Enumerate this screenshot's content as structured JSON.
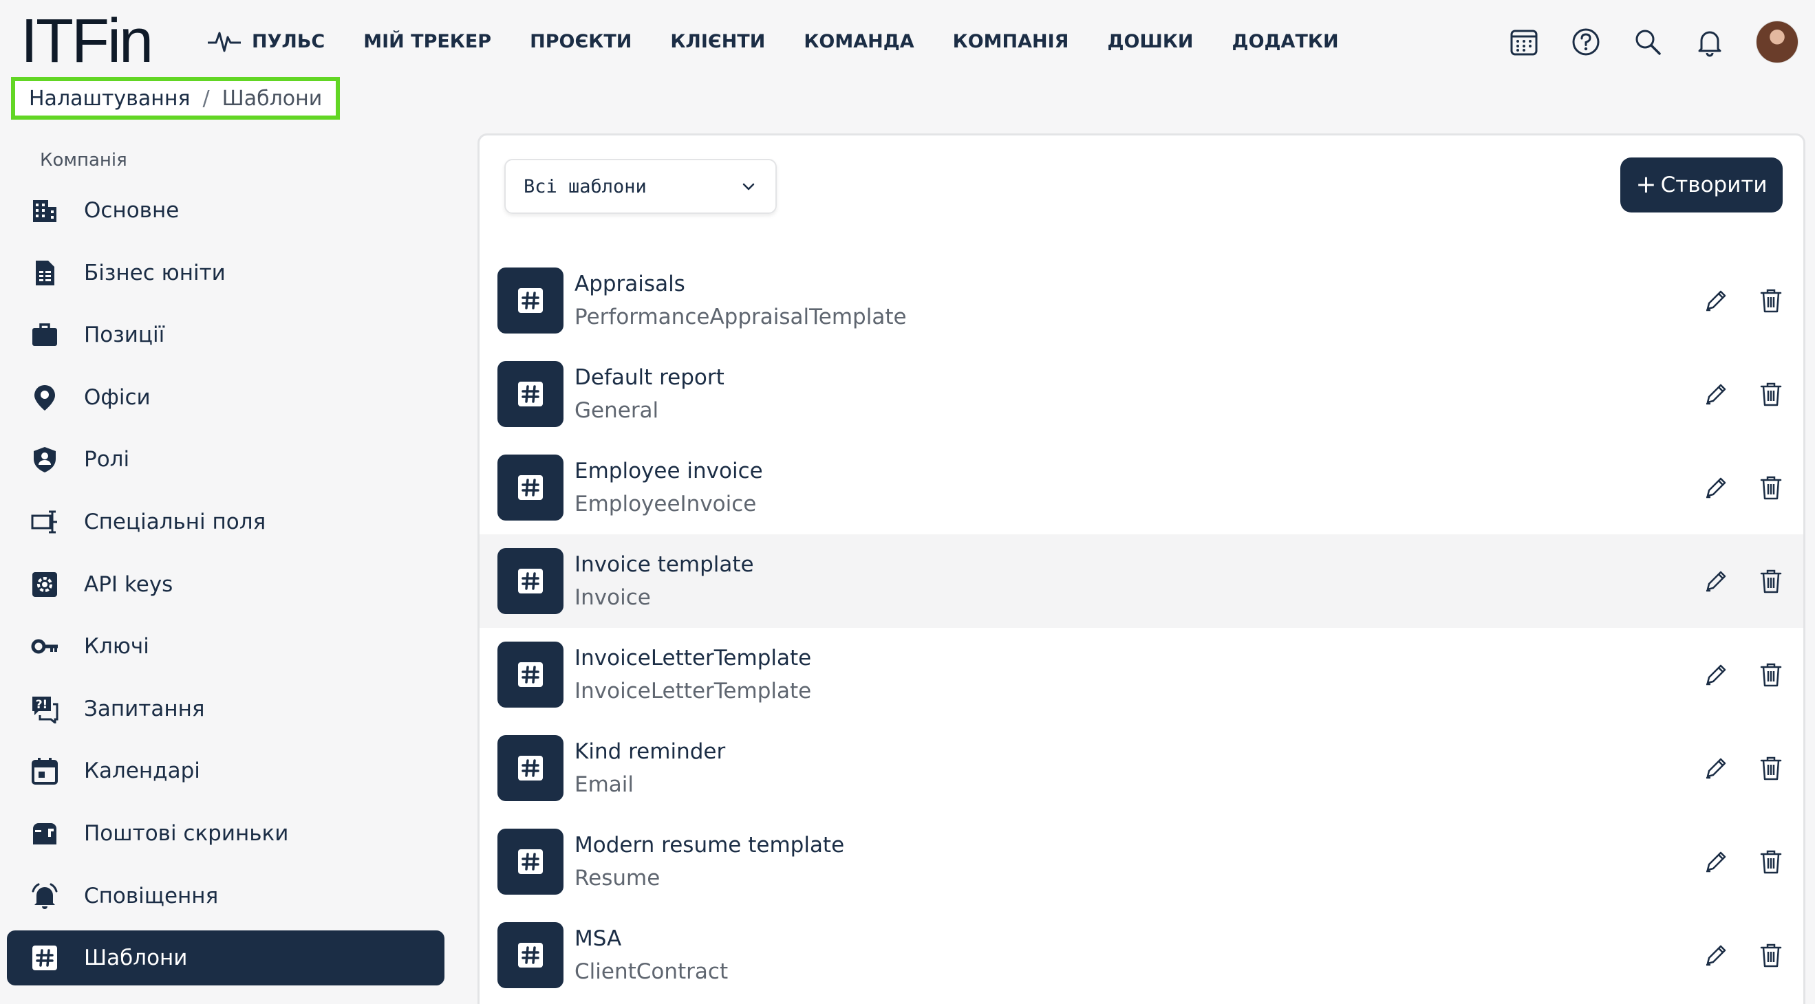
{
  "app": {
    "logo": "ITFin"
  },
  "nav": [
    {
      "label": "ПУЛЬС",
      "icon": "pulse-icon"
    },
    {
      "label": "МІЙ ТРЕКЕР"
    },
    {
      "label": "ПРОЄКТИ"
    },
    {
      "label": "КЛІЄНТИ"
    },
    {
      "label": "КОМАНДА"
    },
    {
      "label": "КОМПАНІЯ"
    },
    {
      "label": "ДОШКИ"
    },
    {
      "label": "ДОДАТКИ"
    }
  ],
  "header_icons": [
    "calendar-icon",
    "help-icon",
    "search-icon",
    "bell-icon",
    "avatar"
  ],
  "breadcrumb": {
    "root": "Налаштування",
    "separator": "/",
    "current": "Шаблони"
  },
  "sidebar": {
    "section": "Компанія",
    "items": [
      {
        "label": "Основне",
        "icon": "building-icon"
      },
      {
        "label": "Бізнес юніти",
        "icon": "document-icon"
      },
      {
        "label": "Позиції",
        "icon": "briefcase-icon"
      },
      {
        "label": "Офіси",
        "icon": "location-pin-icon"
      },
      {
        "label": "Ролі",
        "icon": "shield-user-icon"
      },
      {
        "label": "Спеціальні поля",
        "icon": "custom-field-icon"
      },
      {
        "label": "API keys",
        "icon": "api-gear-icon"
      },
      {
        "label": "Ключі",
        "icon": "key-icon"
      },
      {
        "label": "Запитання",
        "icon": "question-chat-icon"
      },
      {
        "label": "Календарі",
        "icon": "calendar-icon"
      },
      {
        "label": "Поштові скриньки",
        "icon": "mailbox-icon"
      },
      {
        "label": "Сповіщення",
        "icon": "bell-ring-icon"
      },
      {
        "label": "Шаблони",
        "icon": "hashtag-icon",
        "active": true
      }
    ]
  },
  "main": {
    "filter": {
      "selected": "Всі шаблони"
    },
    "create_button": {
      "plus": "+",
      "label": "Створити"
    },
    "templates": [
      {
        "name": "Appraisals",
        "type": "PerformanceAppraisalTemplate"
      },
      {
        "name": "Default report",
        "type": "General"
      },
      {
        "name": "Employee invoice",
        "type": "EmployeeInvoice"
      },
      {
        "name": "Invoice template",
        "type": "Invoice",
        "hovered": true
      },
      {
        "name": "InvoiceLetterTemplate",
        "type": "InvoiceLetterTemplate"
      },
      {
        "name": "Kind reminder",
        "type": "Email"
      },
      {
        "name": "Modern resume template",
        "type": "Resume"
      },
      {
        "name": "MSA",
        "type": "ClientContract"
      }
    ]
  },
  "colors": {
    "primary": "#1b2d45",
    "breadcrumb_highlight": "#62d624",
    "background": "#f6f6f7",
    "panel": "#ffffff"
  }
}
